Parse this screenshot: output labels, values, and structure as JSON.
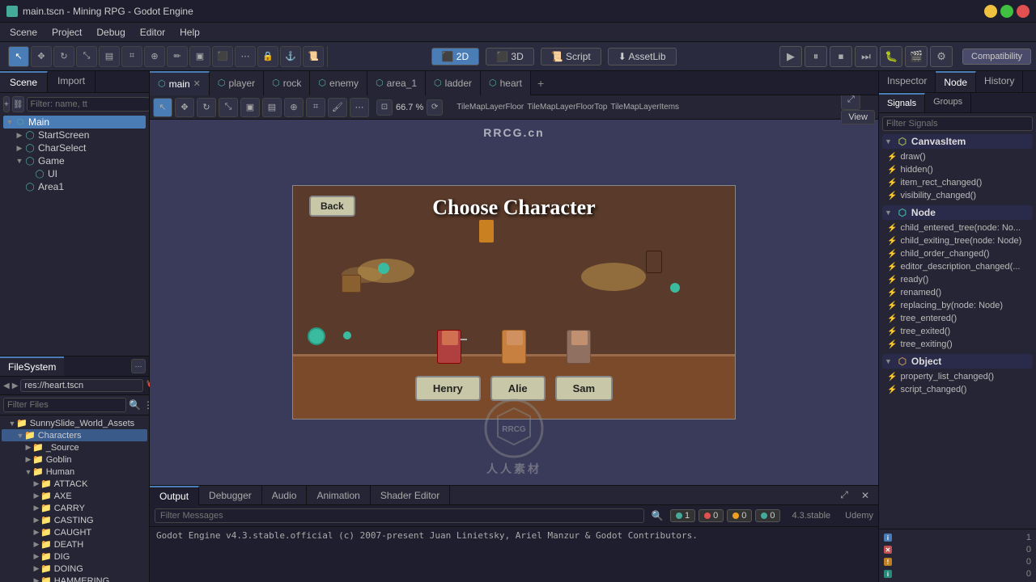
{
  "window": {
    "title": "main.tscn - Mining RPG - Godot Engine"
  },
  "menubar": {
    "items": [
      "Scene",
      "Project",
      "Debug",
      "Editor",
      "Help"
    ]
  },
  "toolbar": {
    "modes": [
      "2D",
      "3D",
      "Script",
      "AssetLib"
    ],
    "active_mode": "2D",
    "zoom_label": "66.7 %",
    "view_label": "View",
    "compat_label": "Compatibility",
    "play_tooltip": "Play",
    "pause_tooltip": "Pause",
    "stop_tooltip": "Stop"
  },
  "scene_panel": {
    "tabs": [
      "Scene",
      "Import"
    ],
    "active_tab": "Scene",
    "search_placeholder": "Filter: name, tt",
    "tree": [
      {
        "id": "main",
        "label": "Main",
        "level": 0,
        "expanded": true,
        "icon": "node"
      },
      {
        "id": "start-screen",
        "label": "StartScreen",
        "level": 1,
        "icon": "node"
      },
      {
        "id": "char-select",
        "label": "CharSelect",
        "level": 1,
        "icon": "node"
      },
      {
        "id": "game",
        "label": "Game",
        "level": 1,
        "expanded": true,
        "icon": "node"
      },
      {
        "id": "ui",
        "label": "UI",
        "level": 2,
        "icon": "node"
      },
      {
        "id": "area1",
        "label": "Area1",
        "level": 1,
        "icon": "node"
      }
    ]
  },
  "file_tabs": [
    {
      "label": "main",
      "active": true,
      "icon": "scene"
    },
    {
      "label": "player",
      "active": false,
      "icon": "scene"
    },
    {
      "label": "rock",
      "active": false,
      "icon": "scene"
    },
    {
      "label": "enemy",
      "active": false,
      "icon": "scene"
    },
    {
      "label": "area_1",
      "active": false,
      "icon": "scene"
    },
    {
      "label": "ladder",
      "active": false,
      "icon": "scene"
    },
    {
      "label": "heart",
      "active": false,
      "icon": "scene"
    }
  ],
  "viewport": {
    "zoom": "66.7 %",
    "active_tool": "select",
    "tilemap_nodes": [
      "TileMapLayerFloor",
      "TileMapLayerFloorTop",
      "TileMapLayerItems"
    ]
  },
  "game_preview": {
    "title": "Choose Character",
    "back_button": "Back",
    "characters": [
      {
        "name": "Henry"
      },
      {
        "name": "Alie"
      },
      {
        "name": "Sam"
      }
    ]
  },
  "filesystem": {
    "tab_label": "FileSystem",
    "path": "res://heart.tscn",
    "filter_placeholder": "Filter Files",
    "tree": [
      {
        "label": "SunnySlide_World_Assets",
        "level": 1,
        "type": "folder",
        "expanded": true
      },
      {
        "label": "Characters",
        "level": 2,
        "type": "folder",
        "expanded": true,
        "active": true
      },
      {
        "label": "_Source",
        "level": 3,
        "type": "folder"
      },
      {
        "label": "Goblin",
        "level": 3,
        "type": "folder"
      },
      {
        "label": "Human",
        "level": 3,
        "type": "folder",
        "expanded": true
      },
      {
        "label": "ATTACK",
        "level": 4,
        "type": "folder"
      },
      {
        "label": "AXE",
        "level": 4,
        "type": "folder"
      },
      {
        "label": "CARRY",
        "level": 4,
        "type": "folder"
      },
      {
        "label": "CASTING",
        "level": 4,
        "type": "folder"
      },
      {
        "label": "CAUGHT",
        "level": 4,
        "type": "folder"
      },
      {
        "label": "DEATH",
        "level": 4,
        "type": "folder"
      },
      {
        "label": "DIG",
        "level": 4,
        "type": "folder"
      },
      {
        "label": "DOING",
        "level": 4,
        "type": "folder"
      },
      {
        "label": "HAMMERING",
        "level": 4,
        "type": "folder"
      }
    ]
  },
  "bottom_panel": {
    "tabs": [
      "Output",
      "Debugger",
      "Audio",
      "Animation",
      "Shader Editor"
    ],
    "active_tab": "Output",
    "filter_placeholder": "Filter Messages",
    "console_text": "Godot Engine v4.3.stable.official (c) 2007-present Juan Linietsky, Ariel Manzur & Godot Contributors.",
    "badges": [
      {
        "type": "info",
        "count": "1"
      },
      {
        "type": "error",
        "count": "0"
      },
      {
        "type": "warn",
        "count": "0"
      },
      {
        "type": "info2",
        "count": "0"
      }
    ],
    "version": "4.3.stable",
    "udemy_label": "Udemy"
  },
  "inspector": {
    "header_tabs": [
      "Inspector",
      "Node",
      "History"
    ],
    "active_tab": "Node",
    "subtabs": [
      "Signals",
      "Groups"
    ],
    "active_subtab": "Signals",
    "filter_placeholder": "Filter Signals",
    "sections": [
      {
        "label": "CanvasItem",
        "signals": [
          "draw()",
          "hidden()",
          "item_rect_changed()",
          "visibility_changed()"
        ]
      },
      {
        "label": "Node",
        "signals": [
          "child_entered_tree(node: No...",
          "child_exiting_tree(node: Node)",
          "child_order_changed()",
          "editor_description_changed(...",
          "ready()",
          "renamed()",
          "replacing_by(node: Node)",
          "tree_entered()",
          "tree_exited()",
          "tree_exiting()"
        ]
      },
      {
        "label": "Object",
        "signals": [
          "property_list_changed()",
          "script_changed()"
        ]
      }
    ],
    "status_items": [
      {
        "type": "blue",
        "label": "",
        "count": "1"
      },
      {
        "type": "red",
        "label": "",
        "count": "0"
      },
      {
        "type": "orange",
        "label": "",
        "count": "0"
      },
      {
        "type": "teal",
        "label": "",
        "count": "0"
      }
    ]
  },
  "watermark": {
    "text": "RRCG.cn"
  }
}
